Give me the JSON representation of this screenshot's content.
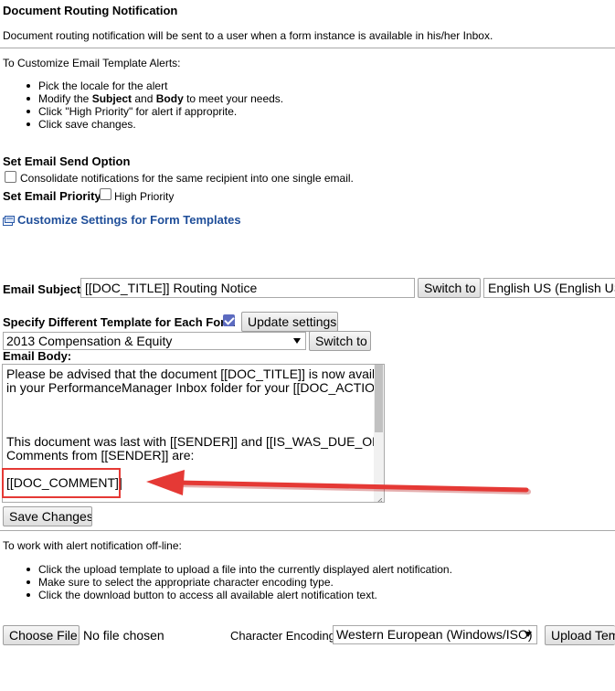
{
  "header": {
    "title": "Document Routing Notification",
    "description": "Document routing notification will be sent to a user when a form instance is available in his/her Inbox."
  },
  "customize": {
    "intro": "To Customize Email Template Alerts:",
    "steps": [
      [
        "Pick the locale for the alert"
      ],
      [
        "Modify the ",
        "Subject",
        " and ",
        "Body",
        " to meet your needs."
      ],
      [
        "Click \"High Priority\" for alert if approprite."
      ],
      [
        "Click save changes."
      ]
    ]
  },
  "send_option": {
    "heading": "Set Email Send Option",
    "consolidate_label": "Consolidate notifications for the same recipient into one single email.",
    "consolidate_checked": false
  },
  "priority": {
    "heading": "Set Email Priority",
    "label": "High Priority",
    "checked": false
  },
  "form_templates_link": "Customize Settings for Form Templates",
  "subject": {
    "label": "Email Subject:",
    "value": "[[DOC_TITLE]] Routing Notice",
    "switch_label": "Switch to",
    "locale": "English US (English US)"
  },
  "template": {
    "label": "Specify Different Template for Each Form",
    "checked": true,
    "update_label": "Update settings",
    "form_selected": "2013 Compensation & Equity",
    "switch_label": "Switch to"
  },
  "body": {
    "label": "Email Body:",
    "lines": [
      "Please be advised that the document [[DOC_TITLE]] is now available",
      "in your PerformanceManager Inbox folder for your [[DOC_ACTION]].",
      "",
      "",
      "This document was last with [[SENDER]] and [[IS_WAS_DUE_ON]].",
      "Comments from [[SENDER]] are:",
      "",
      "[[DOC_COMMENT]]"
    ]
  },
  "save_label": "Save Changes",
  "offline": {
    "intro": "To work with alert notification off-line:",
    "steps": [
      "Click the upload template to upload a file into the currently displayed alert notification.",
      "Make sure to select the appropriate character encoding type.",
      "Click the download button to access all available alert notification text."
    ]
  },
  "file": {
    "choose_label": "Choose File",
    "status": "No file chosen",
    "encoding_label": "Character Encoding:",
    "encoding_value": "Western European (Windows/ISO)",
    "upload_label": "Upload Template"
  },
  "colors": {
    "annotation": "#e53935",
    "link": "#1f4e99"
  },
  "icons": {
    "link_icon": "template-settings-icon",
    "annotation_arrow": "arrow-left-icon"
  }
}
